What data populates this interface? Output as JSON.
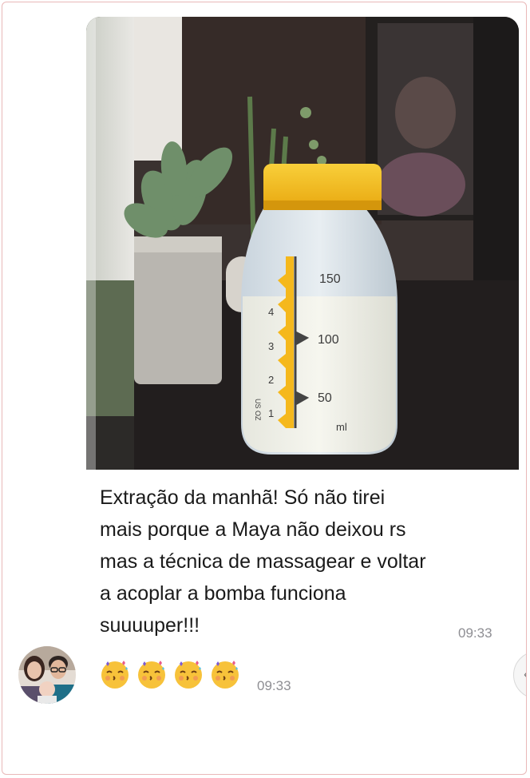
{
  "message": {
    "photo_alt": "Baby bottle with expressed milk",
    "bottle_labels": {
      "ml_150": "150",
      "ml_100": "100",
      "ml_50": "50",
      "unit": "ml",
      "oz_4": "4",
      "oz_3": "3",
      "oz_2": "2",
      "oz_1": "1",
      "oz_unit": "US OZ"
    },
    "caption": "Extração da manhã! Só não tirei\nmais porque a Maya não deixou rs\nmas a técnica de massagear e voltar\na acoplar a bomba funciona\nsuuuuper!!!",
    "time": "09:33"
  },
  "reply": {
    "emojis": [
      "face-blowing-kiss-icon",
      "face-blowing-kiss-icon",
      "face-blowing-kiss-icon",
      "face-blowing-kiss-icon"
    ],
    "time": "09:33"
  },
  "colors": {
    "frame_border": "#e9b8b8",
    "timestamp": "#8e8e93",
    "bottle_cap": "#f6c21a"
  },
  "scroll_button": {
    "icon": "chevron-down-icon",
    "glyph": "‹"
  }
}
